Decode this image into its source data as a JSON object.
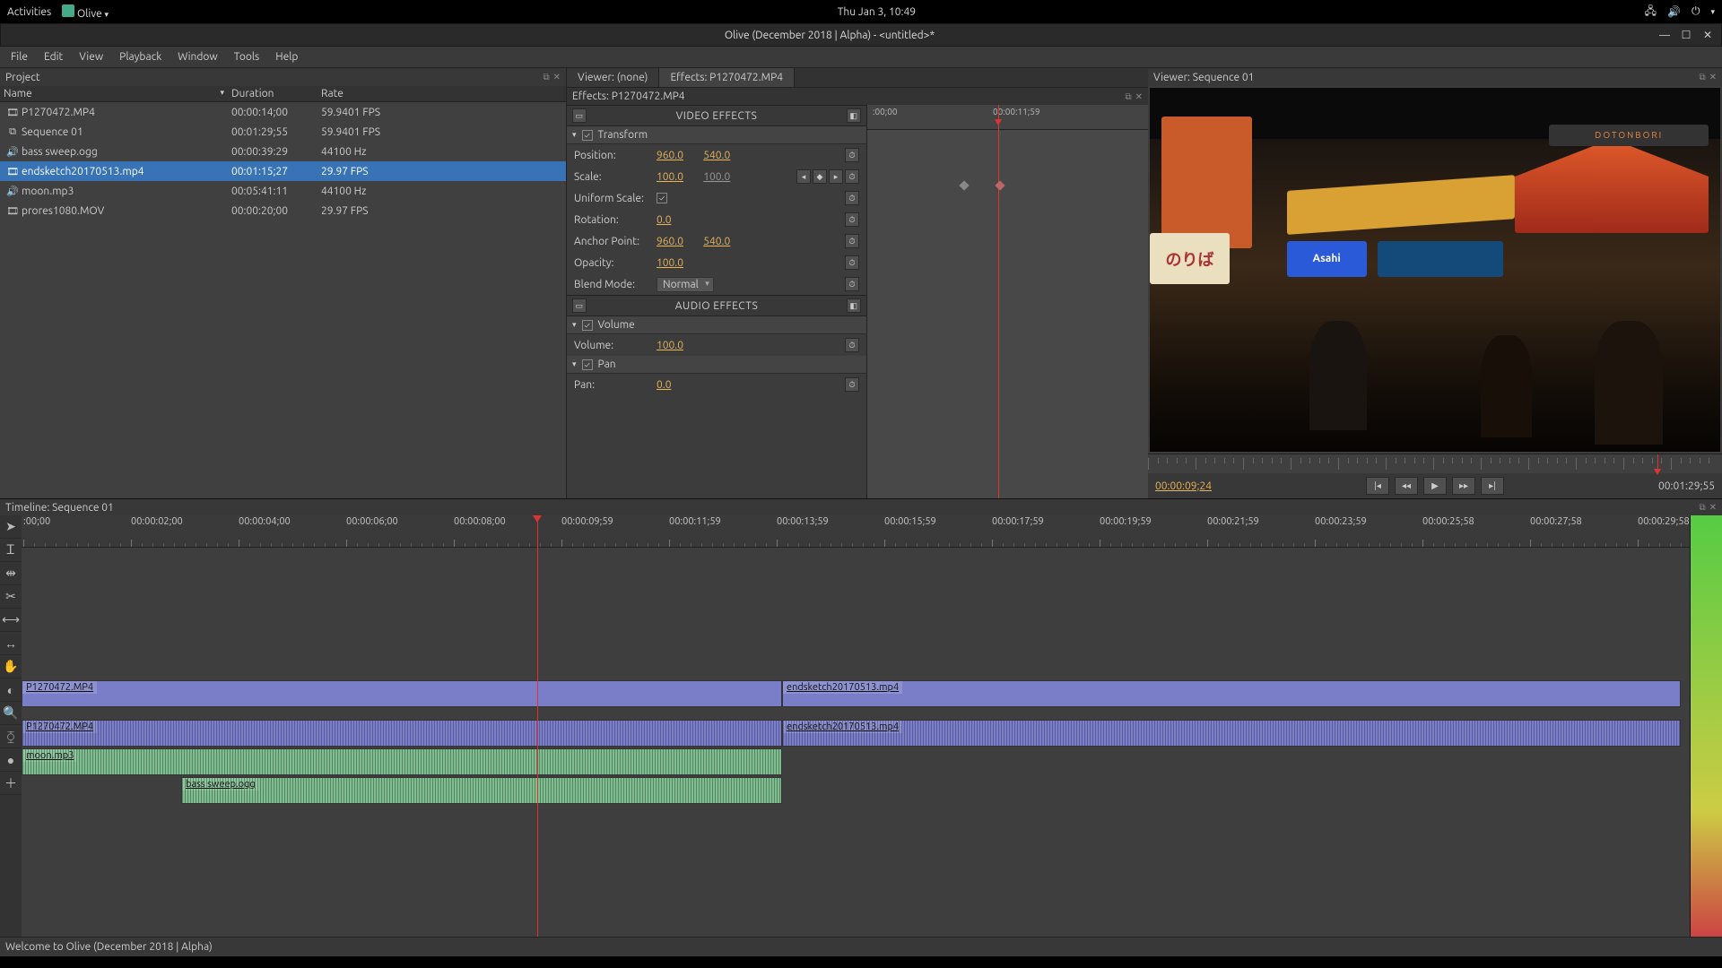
{
  "topbar": {
    "activities": "Activities",
    "app_label": "Olive",
    "clock": "Thu Jan  3, 10:49"
  },
  "window": {
    "title": "Olive (December 2018 | Alpha) - <untitled>*"
  },
  "menu": {
    "file": "File",
    "edit": "Edit",
    "view": "View",
    "playback": "Playback",
    "window": "Window",
    "tools": "Tools",
    "help": "Help"
  },
  "project": {
    "title": "Project",
    "cols": {
      "name": "Name",
      "duration": "Duration",
      "rate": "Rate"
    },
    "rows": [
      {
        "name": "P1270472.MP4",
        "dur": "00:00:14;00",
        "rate": "59.9401 FPS",
        "icon": "🎞"
      },
      {
        "name": "Sequence 01",
        "dur": "00:01:29;55",
        "rate": "59.9401 FPS",
        "icon": "⧉"
      },
      {
        "name": "bass sweep.ogg",
        "dur": "00:00:39:29",
        "rate": "44100 Hz",
        "icon": "🔊"
      },
      {
        "name": "endsketch20170513.mp4",
        "dur": "00:01:15;27",
        "rate": "29.97 FPS",
        "icon": "🎞",
        "selected": true
      },
      {
        "name": "moon.mp3",
        "dur": "00:05:41:11",
        "rate": "44100 Hz",
        "icon": "🔊"
      },
      {
        "name": "prores1080.MOV",
        "dur": "00:00:20;00",
        "rate": "29.97 FPS",
        "icon": "🎞"
      }
    ]
  },
  "effects": {
    "tab_viewer": "Viewer:  (none)",
    "tab_effects": "Effects: P1270472.MP4",
    "header": "Effects: P1270472.MP4",
    "video_section": "VIDEO EFFECTS",
    "audio_section": "AUDIO EFFECTS",
    "transform": {
      "title": "Transform",
      "position_label": "Position:",
      "position_x": "960.0",
      "position_y": "540.0",
      "scale_label": "Scale:",
      "scale_x": "100.0",
      "scale_y": "100.0",
      "uniform_label": "Uniform Scale:",
      "rotation_label": "Rotation:",
      "rotation": "0.0",
      "anchor_label": "Anchor Point:",
      "anchor_x": "960.0",
      "anchor_y": "540.0",
      "opacity_label": "Opacity:",
      "opacity": "100.0",
      "blend_label": "Blend Mode:",
      "blend": "Normal"
    },
    "volume": {
      "title": "Volume",
      "label": "Volume:",
      "value": "100.0"
    },
    "pan": {
      "title": "Pan",
      "label": "Pan:",
      "value": "0.0"
    },
    "kf_ruler": {
      "start": ":00;00",
      "end": "00:00:11;59"
    }
  },
  "viewer": {
    "title": "Viewer: Sequence 01",
    "current": "00:00:09;24",
    "total": "00:01:29;55"
  },
  "timeline": {
    "title": "Timeline: Sequence 01",
    "ruler": [
      ":00;00",
      "00:00:02;00",
      "00:00:04;00",
      "00:00:06;00",
      "00:00:08;00",
      "00:00:09;59",
      "00:00:11;59",
      "00:00:13;59",
      "00:00:15;59",
      "00:00:17;59",
      "00:00:19;59",
      "00:00:21;59",
      "00:00:23;59",
      "00:00:25;58",
      "00:00:27;58",
      "00:00:29;58"
    ],
    "clips": {
      "v1a": "P1270472.MP4",
      "v1b": "endsketch20170513.mp4",
      "a1a": "P1270472.MP4",
      "a1b": "endsketch20170513.mp4",
      "a2": "moon.mp3",
      "a3": "bass sweep.ogg"
    }
  },
  "status": "Welcome to Olive (December 2018 | Alpha)"
}
